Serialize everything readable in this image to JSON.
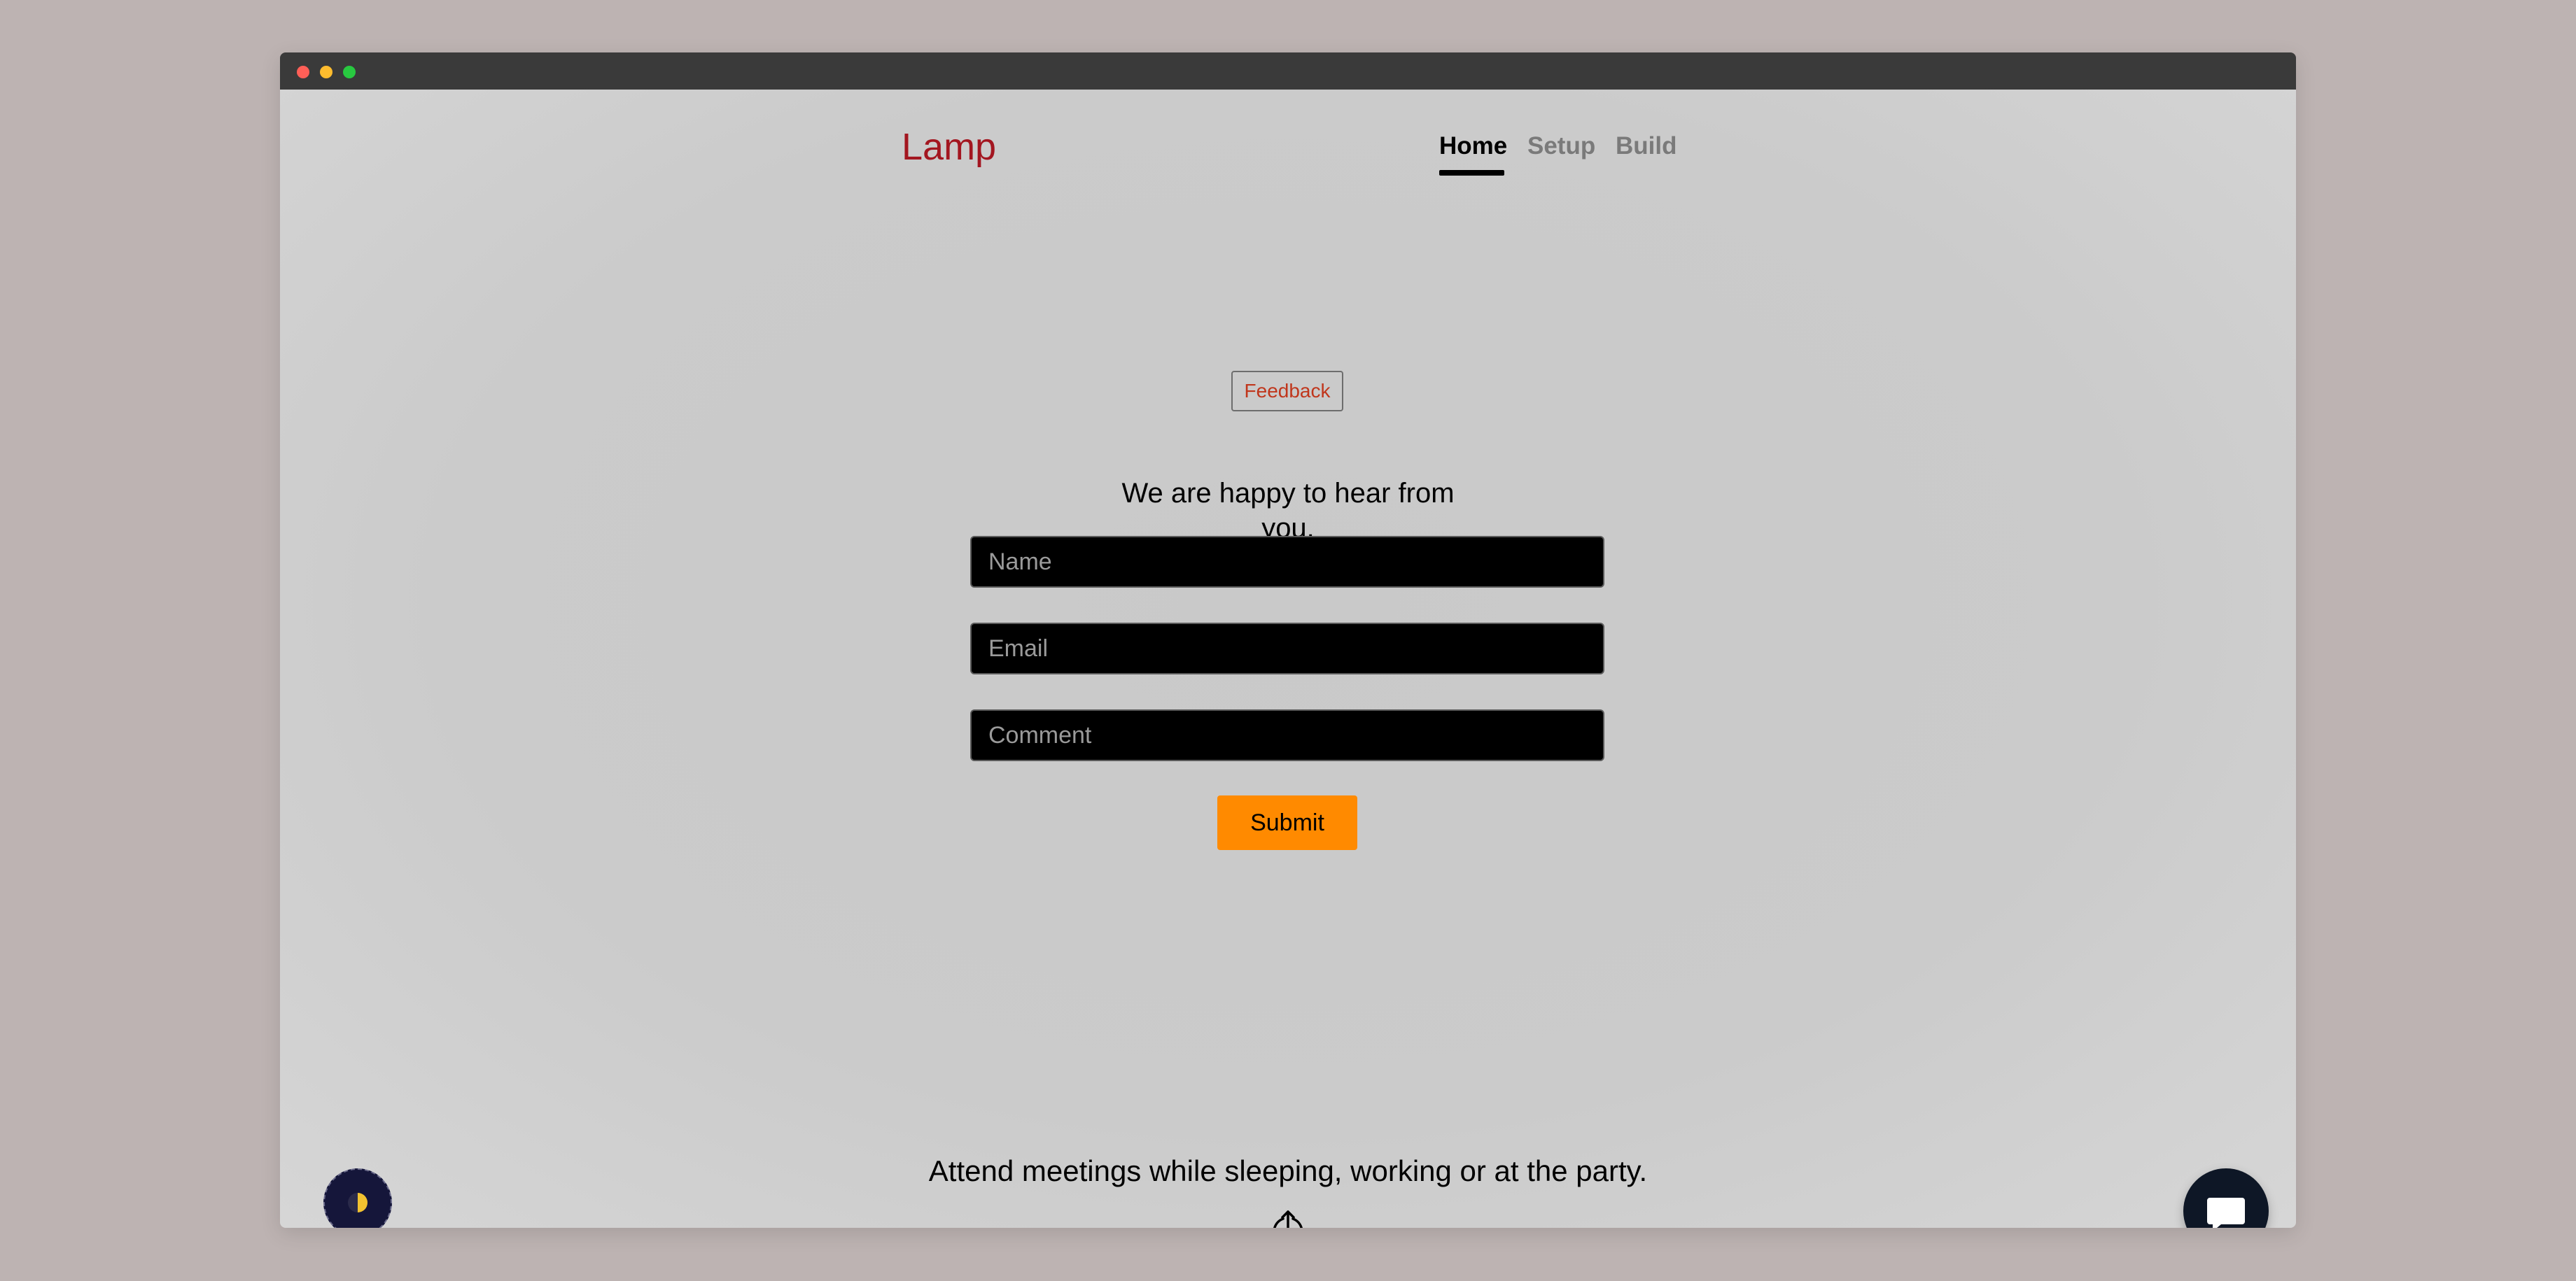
{
  "brand": {
    "name": "Lamp",
    "color": "#a31620"
  },
  "nav": {
    "items": [
      {
        "label": "Home",
        "active": true
      },
      {
        "label": "Setup",
        "active": false
      },
      {
        "label": "Build",
        "active": false
      }
    ]
  },
  "feedback": {
    "badge_label": "Feedback",
    "heading": "We are happy to hear from you.",
    "fields": {
      "name_placeholder": "Name",
      "email_placeholder": "Email",
      "comment_placeholder": "Comment"
    },
    "submit_label": "Submit",
    "accent_color": "#ff8a00"
  },
  "footer": {
    "tagline": "Attend meetings while sleeping, working or at the party.",
    "share_icon": "share-upload-icon"
  },
  "widgets": {
    "theme_toggle_icon": "half-moon-theme-icon",
    "chat_icon": "chat-bubble-icon"
  }
}
